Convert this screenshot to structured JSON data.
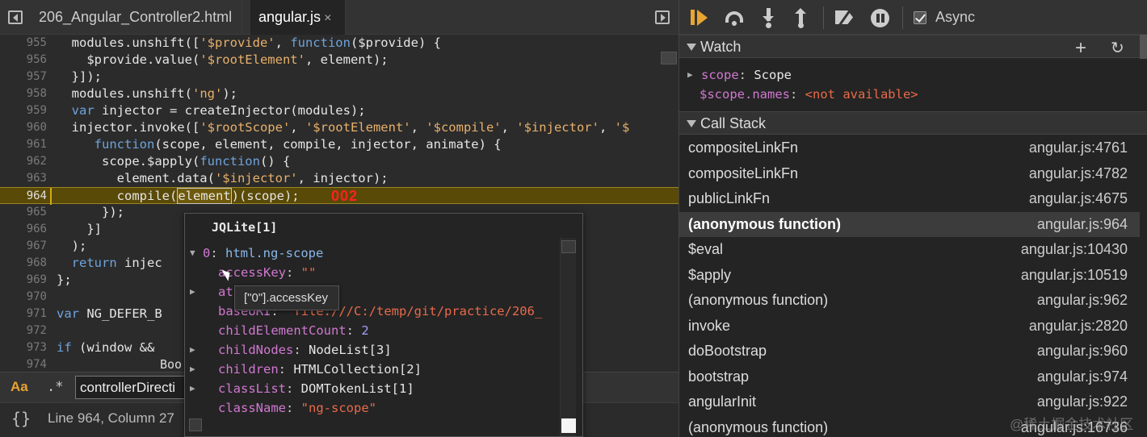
{
  "editor": {
    "tabs": [
      {
        "label": "206_Angular_Controller2.html"
      },
      {
        "label": "angular.js",
        "close": "×"
      }
    ],
    "annotation": "002",
    "search": {
      "case_label": "Aa",
      "regex_label": ".*",
      "value": "controllerDirecti"
    },
    "status": {
      "pretty_print": "{}",
      "cursor": "Line 964, Column 27"
    },
    "hint_fragment": "Boo"
  },
  "popover": {
    "title": "JQLite[1]",
    "root": {
      "arrow": "▼",
      "name": "0",
      "value": "html.ng-scope"
    },
    "props": [
      {
        "arrow": "",
        "name": "accessKey",
        "value": "\"\"",
        "kind": "str"
      },
      {
        "arrow": "▶",
        "name": "at",
        "value": "edNodeMap",
        "kind": "obj"
      },
      {
        "arrow": "",
        "name": "baseURI",
        "value": "\"file:///C:/temp/git/practice/206_",
        "kind": "str"
      },
      {
        "arrow": "",
        "name": "childElementCount",
        "value": "2",
        "kind": "num"
      },
      {
        "arrow": "▶",
        "name": "childNodes",
        "value": "NodeList[3]",
        "kind": "obj"
      },
      {
        "arrow": "▶",
        "name": "children",
        "value": "HTMLCollection[2]",
        "kind": "obj"
      },
      {
        "arrow": "▶",
        "name": "classList",
        "value": "DOMTokenList[1]",
        "kind": "obj"
      },
      {
        "arrow": "",
        "name": "className",
        "value": "\"ng-scope\"",
        "kind": "str"
      }
    ],
    "tooltip": "[\"0\"].accessKey"
  },
  "debugger": {
    "async_label": "Async",
    "watch": {
      "title": "Watch",
      "add": "+",
      "refresh": "↻",
      "items": [
        {
          "arrow": "▶",
          "name": "scope",
          "value": "Scope"
        },
        {
          "arrow": "",
          "name": "$scope.names",
          "value": "<not available>"
        }
      ]
    },
    "callstack": {
      "title": "Call Stack",
      "frames": [
        {
          "name": "compositeLinkFn",
          "location": "angular.js:4761"
        },
        {
          "name": "compositeLinkFn",
          "location": "angular.js:4782"
        },
        {
          "name": "publicLinkFn",
          "location": "angular.js:4675"
        },
        {
          "name": "(anonymous function)",
          "location": "angular.js:964",
          "active": true
        },
        {
          "name": "$eval",
          "location": "angular.js:10430"
        },
        {
          "name": "$apply",
          "location": "angular.js:10519"
        },
        {
          "name": "(anonymous function)",
          "location": "angular.js:962"
        },
        {
          "name": "invoke",
          "location": "angular.js:2820"
        },
        {
          "name": "doBootstrap",
          "location": "angular.js:960"
        },
        {
          "name": "bootstrap",
          "location": "angular.js:974"
        },
        {
          "name": "angularInit",
          "location": "angular.js:922"
        },
        {
          "name": "(anonymous function)",
          "location": "angular.js:16736"
        }
      ]
    }
  },
  "watermark": "@稀土掘金技术社区",
  "code_lines": [
    {
      "num": "955",
      "code": "  modules.unshift(['$provide', function($provide) {"
    },
    {
      "num": "956",
      "code": "    $provide.value('$rootElement', element);"
    },
    {
      "num": "957",
      "code": "  }]);"
    },
    {
      "num": "958",
      "code": "  modules.unshift('ng');"
    },
    {
      "num": "959",
      "code": "  var injector = createInjector(modules);"
    },
    {
      "num": "960",
      "code": "  injector.invoke(['$rootScope', '$rootElement', '$compile', '$injector', '$"
    },
    {
      "num": "961",
      "code": "     function(scope, element, compile, injector, animate) {"
    },
    {
      "num": "962",
      "code": "      scope.$apply(function() {"
    },
    {
      "num": "963",
      "code": "        element.data('$injector', injector);"
    },
    {
      "num": "964",
      "code": "        compile(element)(scope);"
    },
    {
      "num": "965",
      "code": "      });"
    },
    {
      "num": "966",
      "code": "    }]"
    },
    {
      "num": "967",
      "code": "  );"
    },
    {
      "num": "968",
      "code": "  return injec"
    },
    {
      "num": "969",
      "code": "};"
    },
    {
      "num": "970",
      "code": ""
    },
    {
      "num": "971",
      "code": "var NG_DEFER_B"
    },
    {
      "num": "972",
      "code": ""
    },
    {
      "num": "973",
      "code": "if (window && "
    },
    {
      "num": "974",
      "code": ""
    }
  ]
}
